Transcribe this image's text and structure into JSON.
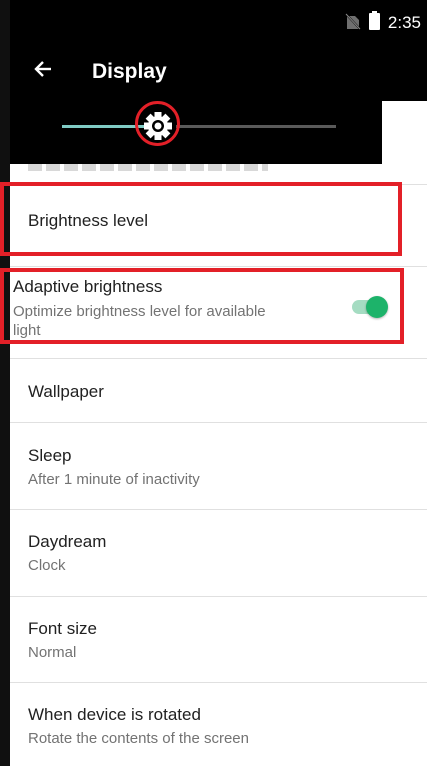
{
  "status_bar": {
    "time": "2:35",
    "icons": [
      "no-sim-icon",
      "battery-icon"
    ]
  },
  "toolbar": {
    "back_icon": "arrow-back-icon",
    "title": "Display"
  },
  "brightness_popup": {
    "level": 0.35,
    "icon": "brightness-gear-icon"
  },
  "settings": {
    "brightness_level": {
      "title": "Brightness level"
    },
    "adaptive_brightness": {
      "title": "Adaptive brightness",
      "subtitle_line1": "Optimize brightness level for available",
      "subtitle_line2": "light",
      "enabled": true
    },
    "wallpaper": {
      "title": "Wallpaper"
    },
    "sleep": {
      "title": "Sleep",
      "subtitle": "After 1 minute of inactivity"
    },
    "daydream": {
      "title": "Daydream",
      "subtitle": "Clock"
    },
    "font_size": {
      "title": "Font size",
      "subtitle": "Normal"
    },
    "rotation": {
      "title": "When device is rotated",
      "subtitle": "Rotate the contents of the screen"
    }
  },
  "colors": {
    "accent": "#1db36a",
    "highlight": "#e32028",
    "slider_active": "#80cbc4"
  }
}
